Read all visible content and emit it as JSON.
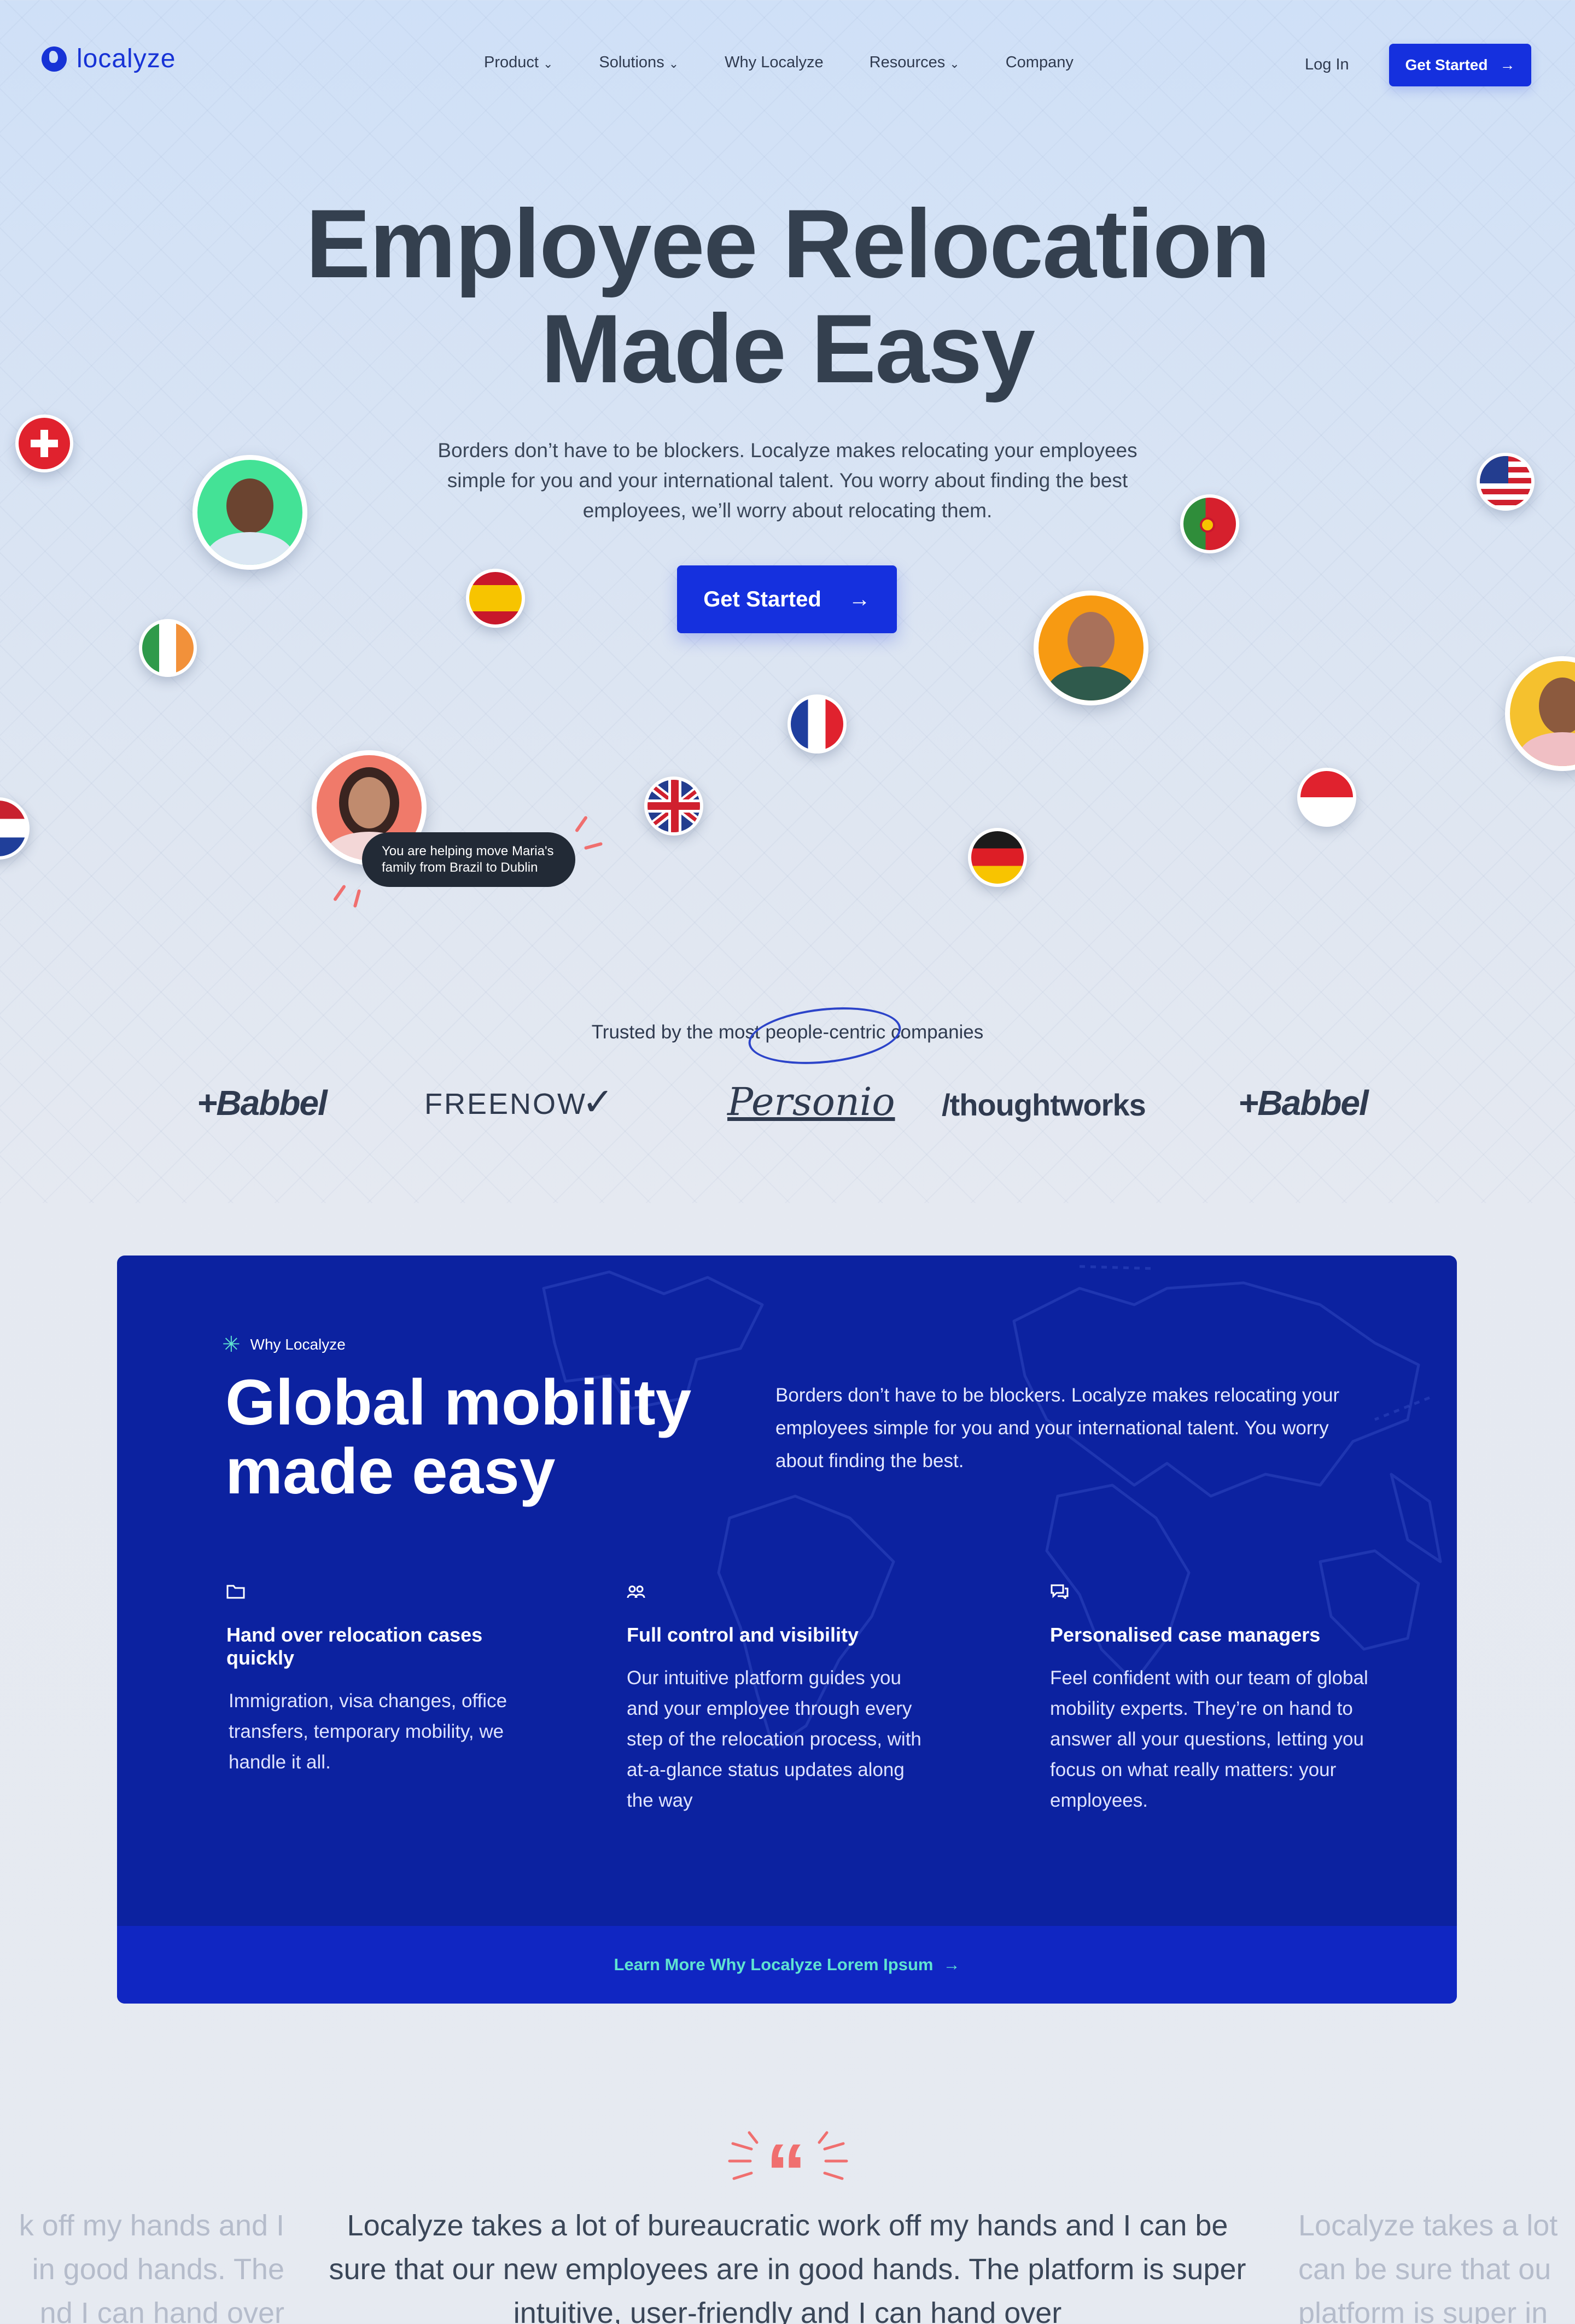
{
  "brand": {
    "name": "localyze",
    "color": "#1530de",
    "accent": "#5fe3d1",
    "coral": "#f06f6f"
  },
  "nav": {
    "items": [
      {
        "label": "Product",
        "dropdown": true
      },
      {
        "label": "Solutions",
        "dropdown": true
      },
      {
        "label": "Why Localyze",
        "dropdown": false
      },
      {
        "label": "Resources",
        "dropdown": true
      },
      {
        "label": "Company",
        "dropdown": false
      }
    ],
    "login": "Log In",
    "cta": "Get Started"
  },
  "hero": {
    "title_line1": "Employee Relocation",
    "title_line2": "Made Easy",
    "subtitle": "Borders don’t have to be blockers. Localyze makes relocating your employees simple for you and your international talent. You worry about finding the best employees, we’ll worry about relocating them.",
    "cta": "Get Started",
    "tooltip_line1": "You are helping move Maria's",
    "tooltip_line2": "family from Brazil to Dublin"
  },
  "trusted": {
    "prefix": "Trusted by the most",
    "highlight": "people-centric",
    "suffix": "companies",
    "logos": [
      "+Babbel",
      "FREENOW",
      "Personio",
      "/thoughtworks",
      "+Babbel"
    ]
  },
  "why": {
    "eyebrow": "Why Localyze",
    "title_line1": "Global mobility",
    "title_line2": "made easy",
    "subtitle": "Borders don’t have to be blockers. Localyze makes relocating your employees simple for you and your international talent. You worry about finding the best.",
    "features": [
      {
        "icon": "folder-icon",
        "title": "Hand over relocation cases quickly",
        "text": "Immigration, visa changes, office transfers, temporary mobility, we handle it all."
      },
      {
        "icon": "team-icon",
        "title": "Full control and visibility",
        "text": "Our intuitive platform guides you and your employee through every step of the relocation process, with at-a-glance status updates along the way"
      },
      {
        "icon": "chat-icon",
        "title": "Personalised case managers",
        "text": "Feel confident with our team of global mobility experts. They’re on hand to answer all your questions, letting you focus on what really matters: your employees."
      }
    ],
    "footer_link": "Learn More Why Localyze Lorem Ipsum"
  },
  "testimonial": {
    "quote": "Localyze takes a lot of bureaucratic work off my hands and I can be sure that our new employees are in good hands. The platform is super intuitive, user-friendly and I can hand over",
    "left_fragment": "k off my hands and I\nin good hands. The\nnd I can hand over",
    "right_fragment": "Localyze takes a lot\ncan be sure that ou\nplatform is super in"
  }
}
